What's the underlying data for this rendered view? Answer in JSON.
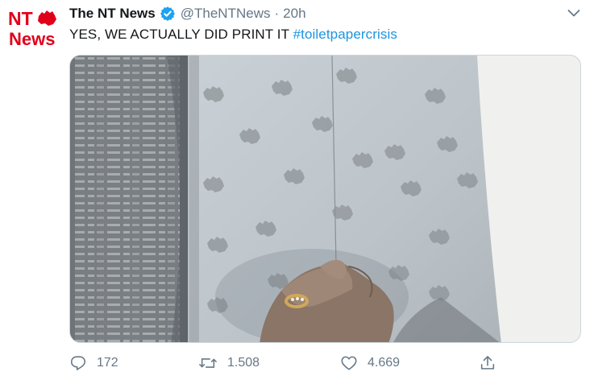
{
  "tweet": {
    "author": {
      "name": "The NT News",
      "handle": "@TheNTNews",
      "verified": true,
      "avatar_logo": {
        "line1": "NT",
        "line2": "News",
        "icon": "australia-map-icon",
        "color": "#e0001a"
      }
    },
    "separator": "·",
    "time": "20h",
    "text": "YES, WE ACTUALLY DID PRINT IT",
    "hashtag": "#toiletpapercrisis",
    "media": {
      "kind": "video-still",
      "icon": "newsprint-toilet-paper-photo"
    },
    "actions": {
      "reply": {
        "icon": "reply-icon",
        "count": "172"
      },
      "retweet": {
        "icon": "retweet-icon",
        "count": "1.508"
      },
      "like": {
        "icon": "heart-icon",
        "count": "4.669"
      },
      "share": {
        "icon": "share-icon"
      }
    },
    "menu_icon": "chevron-down-icon"
  },
  "colors": {
    "link": "#1b95e0",
    "secondary": "#657786",
    "verified": "#1da1f2",
    "brand_red": "#e0001a"
  }
}
